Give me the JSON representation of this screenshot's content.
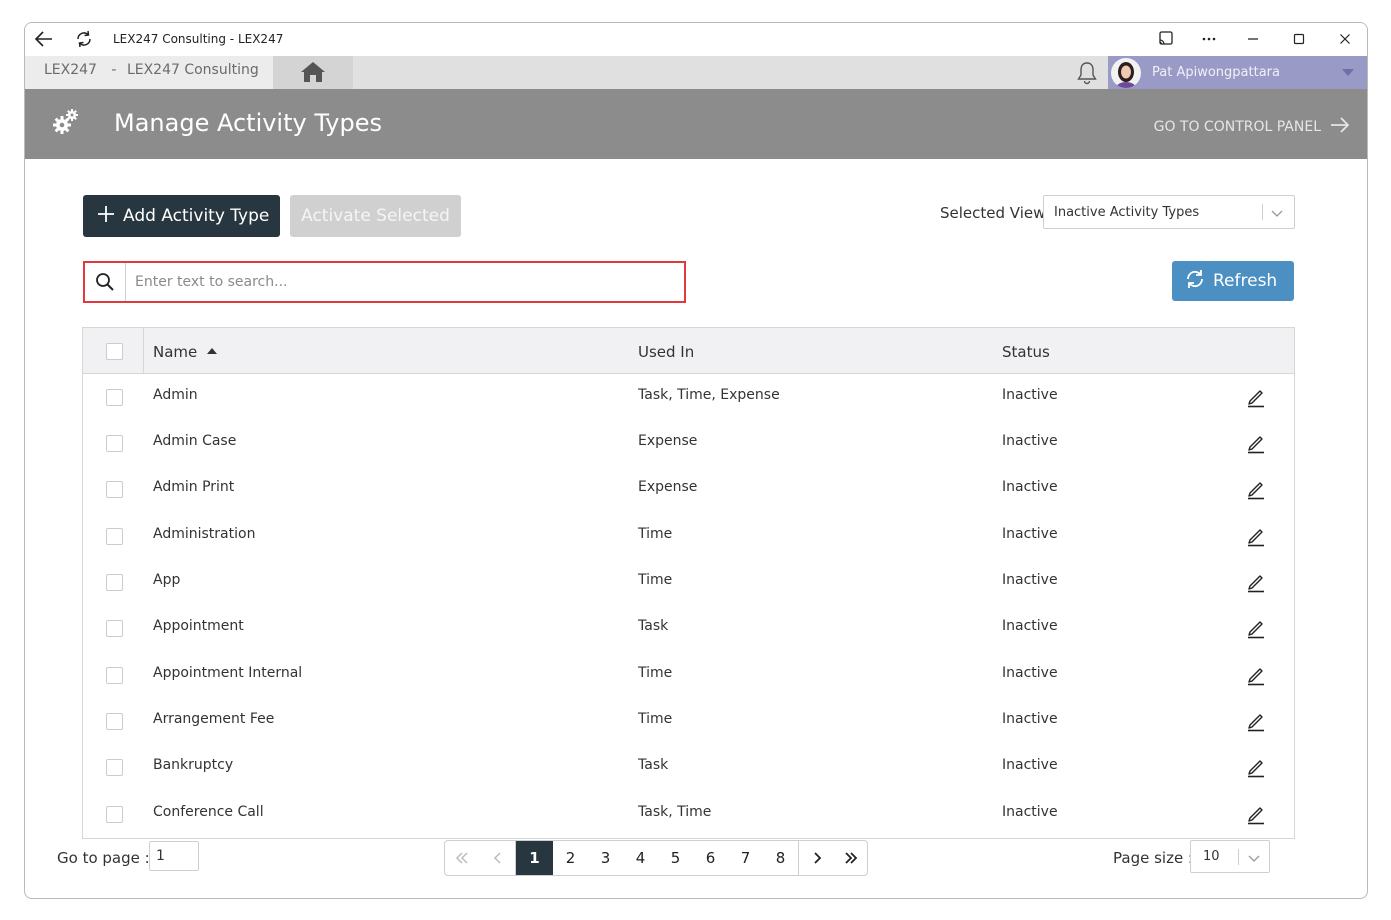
{
  "window": {
    "title": "LEX247 Consulting - LEX247"
  },
  "appbar": {
    "tenant_code": "LEX247",
    "tenant_sep": "-",
    "tenant_name": "LEX247 Consulting",
    "user_name": "Pat Apiwongpattara"
  },
  "header": {
    "title": "Manage Activity Types",
    "control_panel_link": "GO TO CONTROL PANEL"
  },
  "toolbar": {
    "add_label": "Add Activity Type",
    "activate_label": "Activate Selected",
    "selected_view_label": "Selected View",
    "selected_view_value": "Inactive Activity Types",
    "refresh_label": "Refresh"
  },
  "search": {
    "placeholder": "Enter text to search...",
    "value": ""
  },
  "grid": {
    "columns": {
      "name": "Name",
      "used_in": "Used In",
      "status": "Status"
    },
    "sort": "name-ascending",
    "rows": [
      {
        "name": "Admin",
        "used_in": "Task, Time, Expense",
        "status": "Inactive"
      },
      {
        "name": "Admin Case",
        "used_in": "Expense",
        "status": "Inactive"
      },
      {
        "name": "Admin Print",
        "used_in": "Expense",
        "status": "Inactive"
      },
      {
        "name": "Administration",
        "used_in": "Time",
        "status": "Inactive"
      },
      {
        "name": "App",
        "used_in": "Time",
        "status": "Inactive"
      },
      {
        "name": "Appointment",
        "used_in": "Task",
        "status": "Inactive"
      },
      {
        "name": "Appointment Internal",
        "used_in": "Time",
        "status": "Inactive"
      },
      {
        "name": "Arrangement Fee",
        "used_in": "Time",
        "status": "Inactive"
      },
      {
        "name": "Bankruptcy",
        "used_in": "Task",
        "status": "Inactive"
      },
      {
        "name": "Conference Call",
        "used_in": "Task, Time",
        "status": "Inactive"
      }
    ]
  },
  "footer": {
    "goto_label": "Go to page :",
    "goto_value": "1",
    "pages": [
      "1",
      "2",
      "3",
      "4",
      "5",
      "6",
      "7",
      "8"
    ],
    "current_page": "1",
    "page_size_label": "Page size :",
    "page_size_value": "10"
  },
  "colors": {
    "header_bg": "#8c8c8c",
    "primary_dark": "#283640",
    "refresh_blue": "#4c8fc2",
    "user_bg": "#9a9ac6",
    "search_highlight": "#e0393e"
  },
  "icons": [
    "back-arrow-icon",
    "reload-icon",
    "cast-icon",
    "more-icon",
    "minimize-icon",
    "maximize-icon",
    "close-icon",
    "home-icon",
    "bell-icon",
    "gear-icon",
    "arrow-right-icon",
    "plus-icon",
    "search-icon",
    "refresh-icon",
    "chevron-down-icon",
    "edit-icon",
    "first-page-icon",
    "prev-page-icon",
    "next-page-icon",
    "last-page-icon"
  ]
}
